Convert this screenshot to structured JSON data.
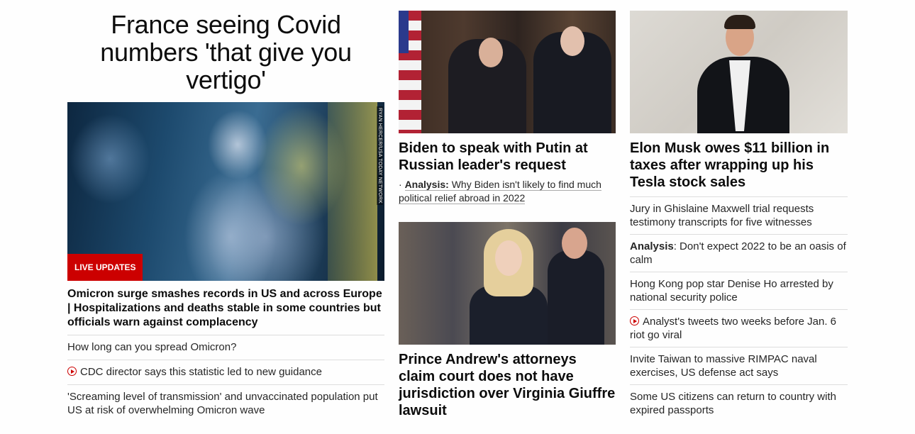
{
  "col1": {
    "hero_title": "France seeing Covid numbers 'that give you vertigo'",
    "photo_credit": "RYAN HERCER/USA TODAY NETWORK",
    "badge": "LIVE UPDATES",
    "lead_headline": "Omicron surge smashes records in US and across Europe | Hospitalizations and deaths stable in some countries but officials warn against complacency",
    "items": [
      "How long can you spread Omicron?",
      "CDC director says this statistic led to new guidance",
      "'Screaming level of transmission' and unvaccinated population put US at risk of overwhelming Omicron wave"
    ]
  },
  "col2": {
    "card1_headline": "Biden to speak with Putin at Russian leader's request",
    "card1_analysis_label": "Analysis:",
    "card1_analysis_text": "Why Biden isn't likely to find much political relief abroad in 2022",
    "card2_headline": "Prince Andrew's attorneys claim court does not have jurisdiction over Virginia Giuffre lawsuit"
  },
  "col3": {
    "card_headline": "Elon Musk owes $11 billion in taxes after wrapping up his Tesla stock sales",
    "items": [
      "Jury in Ghislaine Maxwell trial requests testimony transcripts for five witnesses",
      "Don't expect 2022 to be an oasis of calm",
      "Hong Kong pop star Denise Ho arrested by national security police",
      "Analyst's tweets two weeks before Jan. 6 riot go viral",
      "Invite Taiwan to massive RIMPAC naval exercises, US defense act says",
      "Some US citizens can return to country with expired passports"
    ],
    "analysis_label": "Analysis"
  },
  "colors": {
    "accent": "#cc0000",
    "text": "#262626",
    "divider": "#dddddd"
  },
  "icons": {
    "video": "play-circle-icon"
  }
}
